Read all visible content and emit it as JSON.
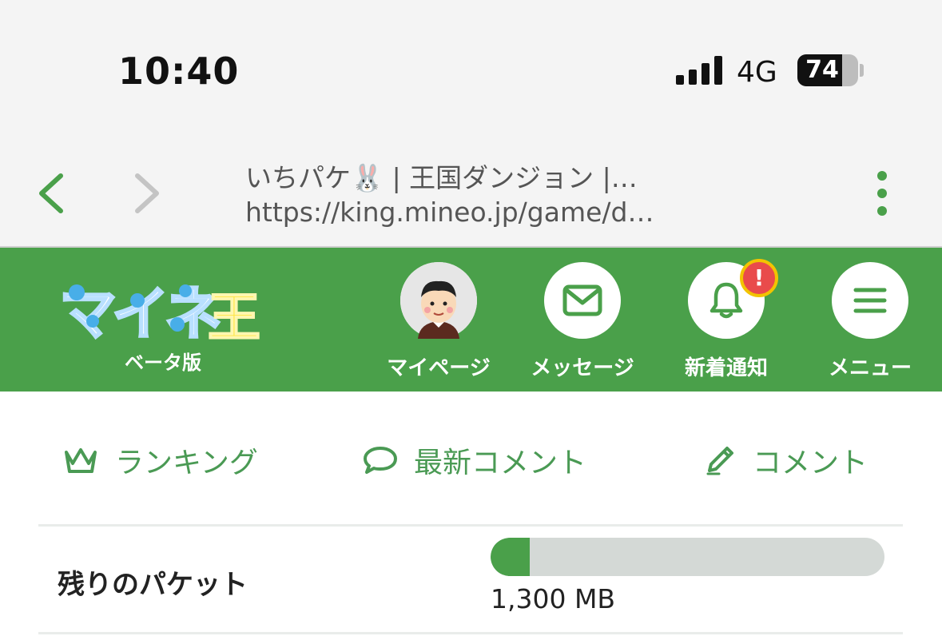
{
  "status_bar": {
    "time": "10:40",
    "network": "4G",
    "battery_level": "74",
    "battery_fraction": 0.74
  },
  "browser": {
    "title": "いちパケ🐰 | 王国ダンジョン |…",
    "url": "https://king.mineo.jp/game/d…"
  },
  "header": {
    "logo_text": "マイネ王",
    "logo_sub": "ベータ版",
    "nav": [
      {
        "label": "マイページ",
        "icon": "avatar"
      },
      {
        "label": "メッセージ",
        "icon": "envelope-icon"
      },
      {
        "label": "新着通知",
        "icon": "bell-icon",
        "badge": "!"
      },
      {
        "label": "メニュー",
        "icon": "hamburger-icon"
      }
    ]
  },
  "tabs": [
    {
      "label": "ランキング",
      "icon": "crown-icon"
    },
    {
      "label": "最新コメント",
      "icon": "speech-bubble-icon"
    },
    {
      "label": "コメント",
      "icon": "pencil-icon"
    }
  ],
  "packet": {
    "label": "残りのパケット",
    "value": "1,300 MB",
    "fraction": 0.1
  },
  "colors": {
    "brand_green": "#4aa04a",
    "tab_text": "#4a9a54",
    "badge_red": "#e94b4b",
    "badge_border": "#f2c400"
  }
}
